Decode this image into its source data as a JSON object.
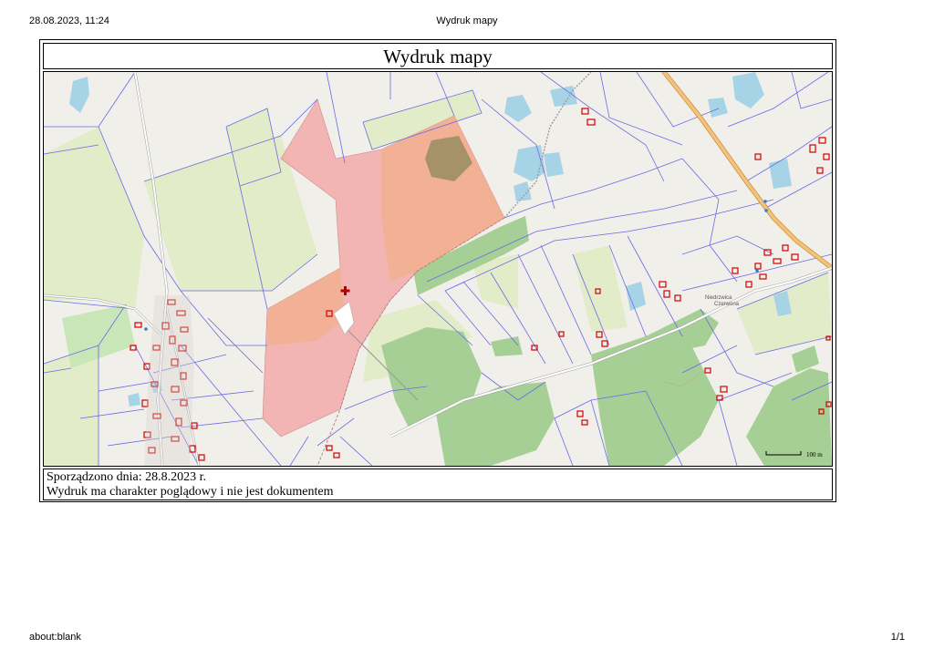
{
  "print_header": {
    "datetime": "28.08.2023, 11:24",
    "title": "Wydruk mapy"
  },
  "map_print": {
    "title": "Wydruk mapy",
    "scale_label": "100 m",
    "place_label_line1": "Niedrzwica",
    "place_label_line2": "Czerwona",
    "prepared_date": "Sporządzono dnia: 28.8.2023 r.",
    "disclaimer": "Wydruk ma charakter poglądowy i nie jest dokumentem"
  },
  "print_footer": {
    "url": "about:blank",
    "page": "1/1"
  },
  "colors": {
    "parcel_line": "#6a6ae6",
    "forest": "#a6cf95",
    "meadow": "#e3ecc8",
    "selection": "#f4a6a6",
    "selection_overlap": "#f1b08e",
    "water": "#a7d3e6",
    "building": "#d00000",
    "road": "#f5c27a",
    "marker": "#b00000"
  }
}
